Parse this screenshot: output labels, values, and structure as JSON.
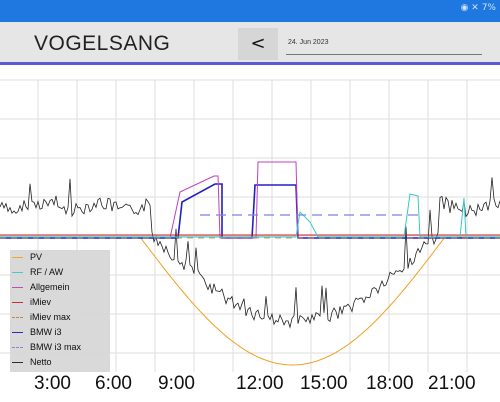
{
  "status_icons": "◉ ✕ 7%",
  "header": {
    "title": "VOGELSANG",
    "back_label": "<",
    "date": "24. Jun 2023"
  },
  "legend": [
    {
      "label": "PV",
      "color": "#f0a020",
      "style": "solid"
    },
    {
      "label": "RF / AW",
      "color": "#38c8c8",
      "style": "solid"
    },
    {
      "label": "Allgemein",
      "color": "#c040c0",
      "style": "solid"
    },
    {
      "label": "iMiev",
      "color": "#d02020",
      "style": "solid"
    },
    {
      "label": "iMiev max",
      "color": "#c08040",
      "style": "dashed"
    },
    {
      "label": "BMW i3",
      "color": "#2020c0",
      "style": "solid"
    },
    {
      "label": "BMW i3 max",
      "color": "#8080e0",
      "style": "dashed"
    },
    {
      "label": "Netto",
      "color": "#222222",
      "style": "solid"
    }
  ],
  "chart_data": {
    "type": "line",
    "x_ticks": [
      "3:00",
      "6:00",
      "9:00",
      "12:00",
      "15:00",
      "18:00",
      "21:00"
    ],
    "series": [
      {
        "name": "PV"
      },
      {
        "name": "RF / AW"
      },
      {
        "name": "Allgemein"
      },
      {
        "name": "iMiev"
      },
      {
        "name": "iMiev max"
      },
      {
        "name": "BMW i3"
      },
      {
        "name": "BMW i3 max"
      },
      {
        "name": "Netto"
      }
    ],
    "grid": true
  }
}
